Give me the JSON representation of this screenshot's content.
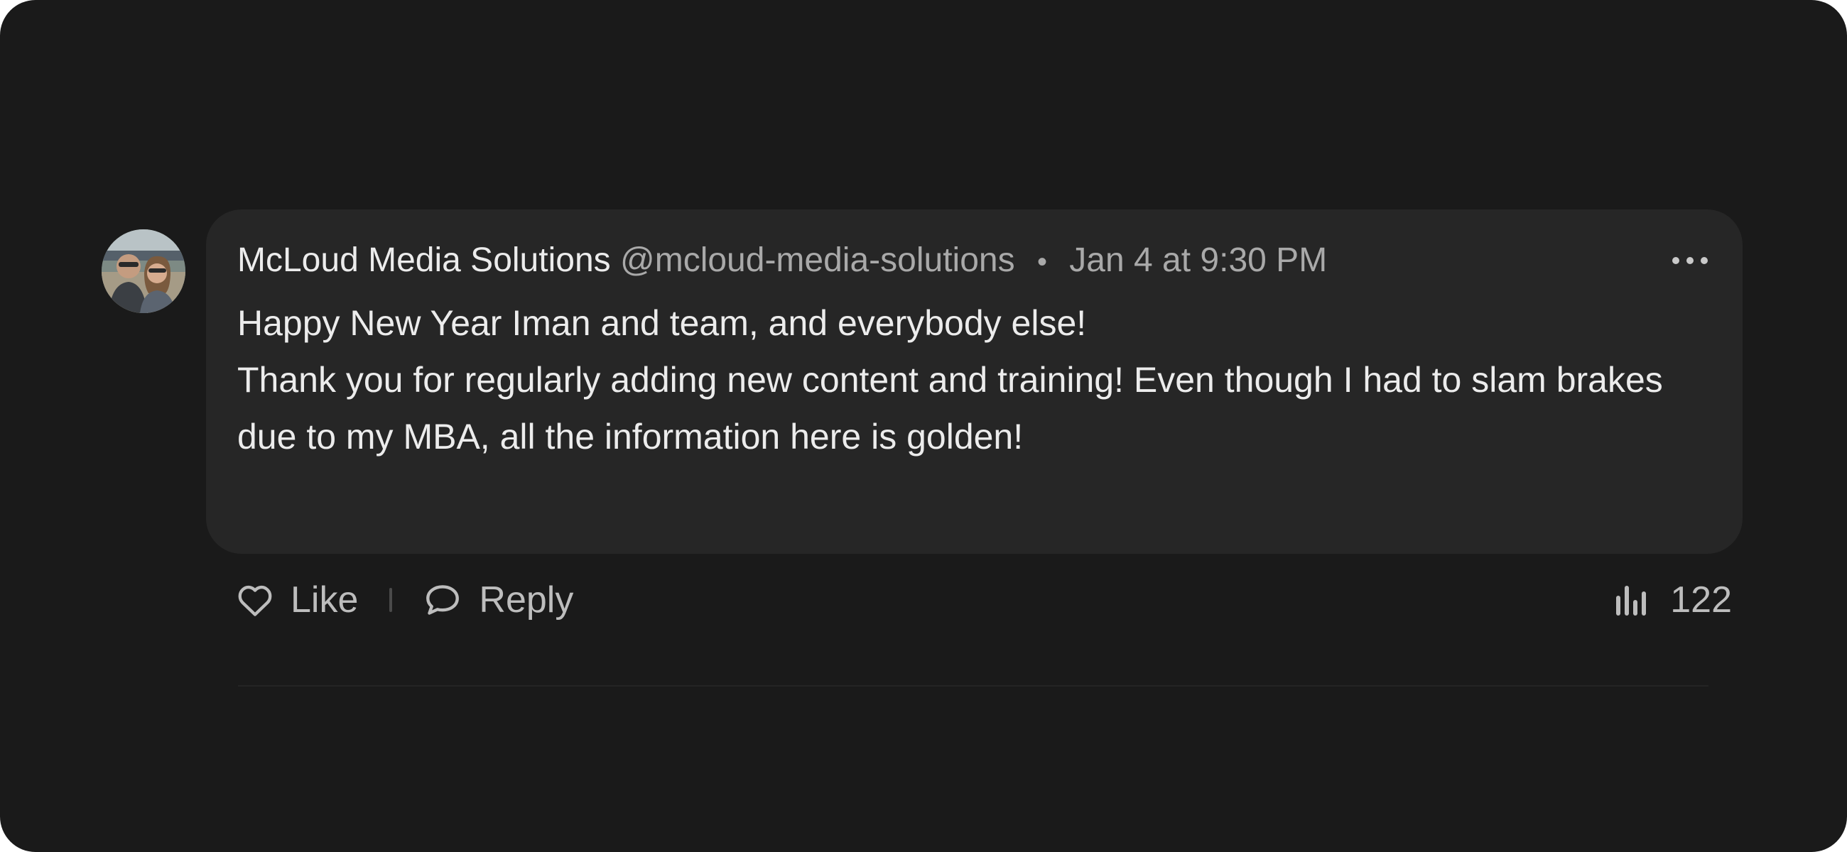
{
  "comment": {
    "author": "McLoud Media Solutions",
    "handle": "@mcloud-media-solutions",
    "separator": "•",
    "timestamp": "Jan 4 at 9:30 PM",
    "lines": [
      "Happy New Year Iman and team, and everybody else!",
      "Thank you for regularly adding new content and training! Even though I had to slam brakes due to my MBA, all the information here is golden!"
    ],
    "avatar_icon": "user-photo-avatar",
    "more_icon": "more-horizontal-icon"
  },
  "actions": {
    "like_label": "Like",
    "like_icon": "heart-outline-icon",
    "reply_label": "Reply",
    "reply_icon": "chat-bubble-outline-icon",
    "views_count": "122",
    "views_icon": "bar-chart-icon"
  },
  "colors": {
    "background": "#1a1a1a",
    "bubble": "#262626",
    "text_primary": "#ececec",
    "text_secondary": "#a9a9a9"
  }
}
